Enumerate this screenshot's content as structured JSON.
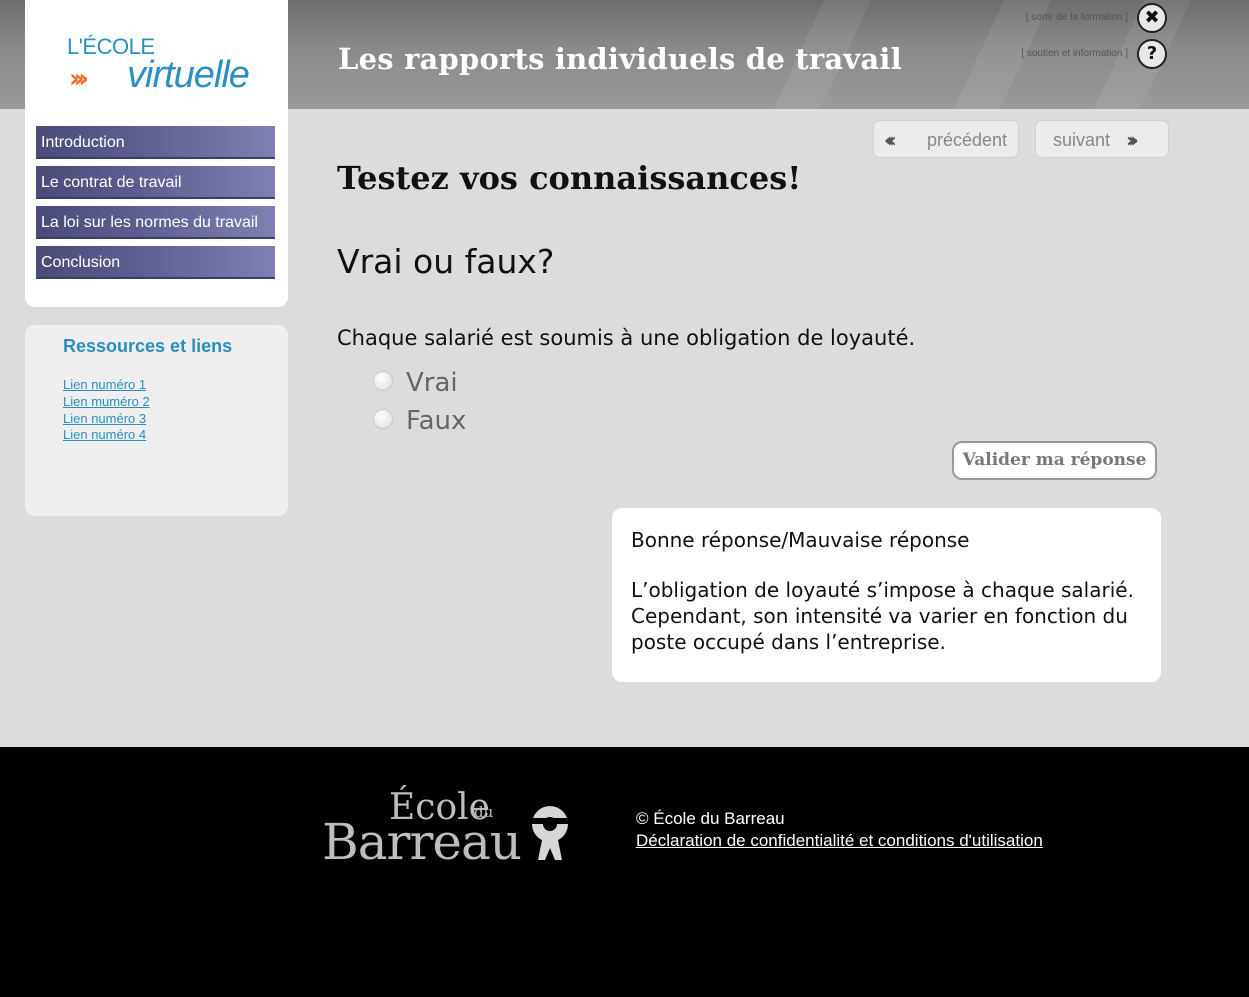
{
  "header": {
    "title": "Les rapports individuels de travail",
    "exit_label": "[ sortir de la formation ]",
    "help_label": "[ soutien et information ]",
    "exit_icon": "✖",
    "help_icon": "?"
  },
  "logo": {
    "line1": "L'ÉCOLE",
    "arrows": "›››",
    "line2": "virtuelle"
  },
  "nav": {
    "items": [
      {
        "label": "Introduction"
      },
      {
        "label": "Le contrat de travail"
      },
      {
        "label": "La loi sur les normes du travail"
      },
      {
        "label": "Conclusion"
      }
    ]
  },
  "resources": {
    "title": "Ressources et liens",
    "links": [
      "Lien numéro 1",
      "Lien muméro 2",
      "Lien numéro 3",
      "Lien numéro 4"
    ]
  },
  "pager": {
    "prev_label": "précédent",
    "next_label": "suivant",
    "prev_arrows": "‹‹‹",
    "next_arrows": "›››"
  },
  "quiz": {
    "heading": "Testez vos connaissances!",
    "subheading": "Vrai ou faux?",
    "question": "Chaque salarié est soumis à une obligation de loyauté.",
    "options": [
      "Vrai",
      "Faux"
    ],
    "validate_label": "Valider ma réponse"
  },
  "feedback": {
    "title": "Bonne réponse/Mauvaise réponse",
    "text": "L’obligation de loyauté s’impose à chaque salarié. Cependant, son intensité va varier en fonction du poste occupé dans l’entreprise."
  },
  "footer": {
    "logo_ecole": "École",
    "logo_du": "du",
    "logo_barreau": "Barreau",
    "copyright": "© École du Barreau",
    "policy_link": "Déclaration de confidentialité et conditions d'utilisation"
  },
  "colors": {
    "nav_bg": "#5c5c8f",
    "link": "#2a8fbf",
    "logo_blue": "#2b8fc0",
    "logo_orange": "#f26a21"
  }
}
